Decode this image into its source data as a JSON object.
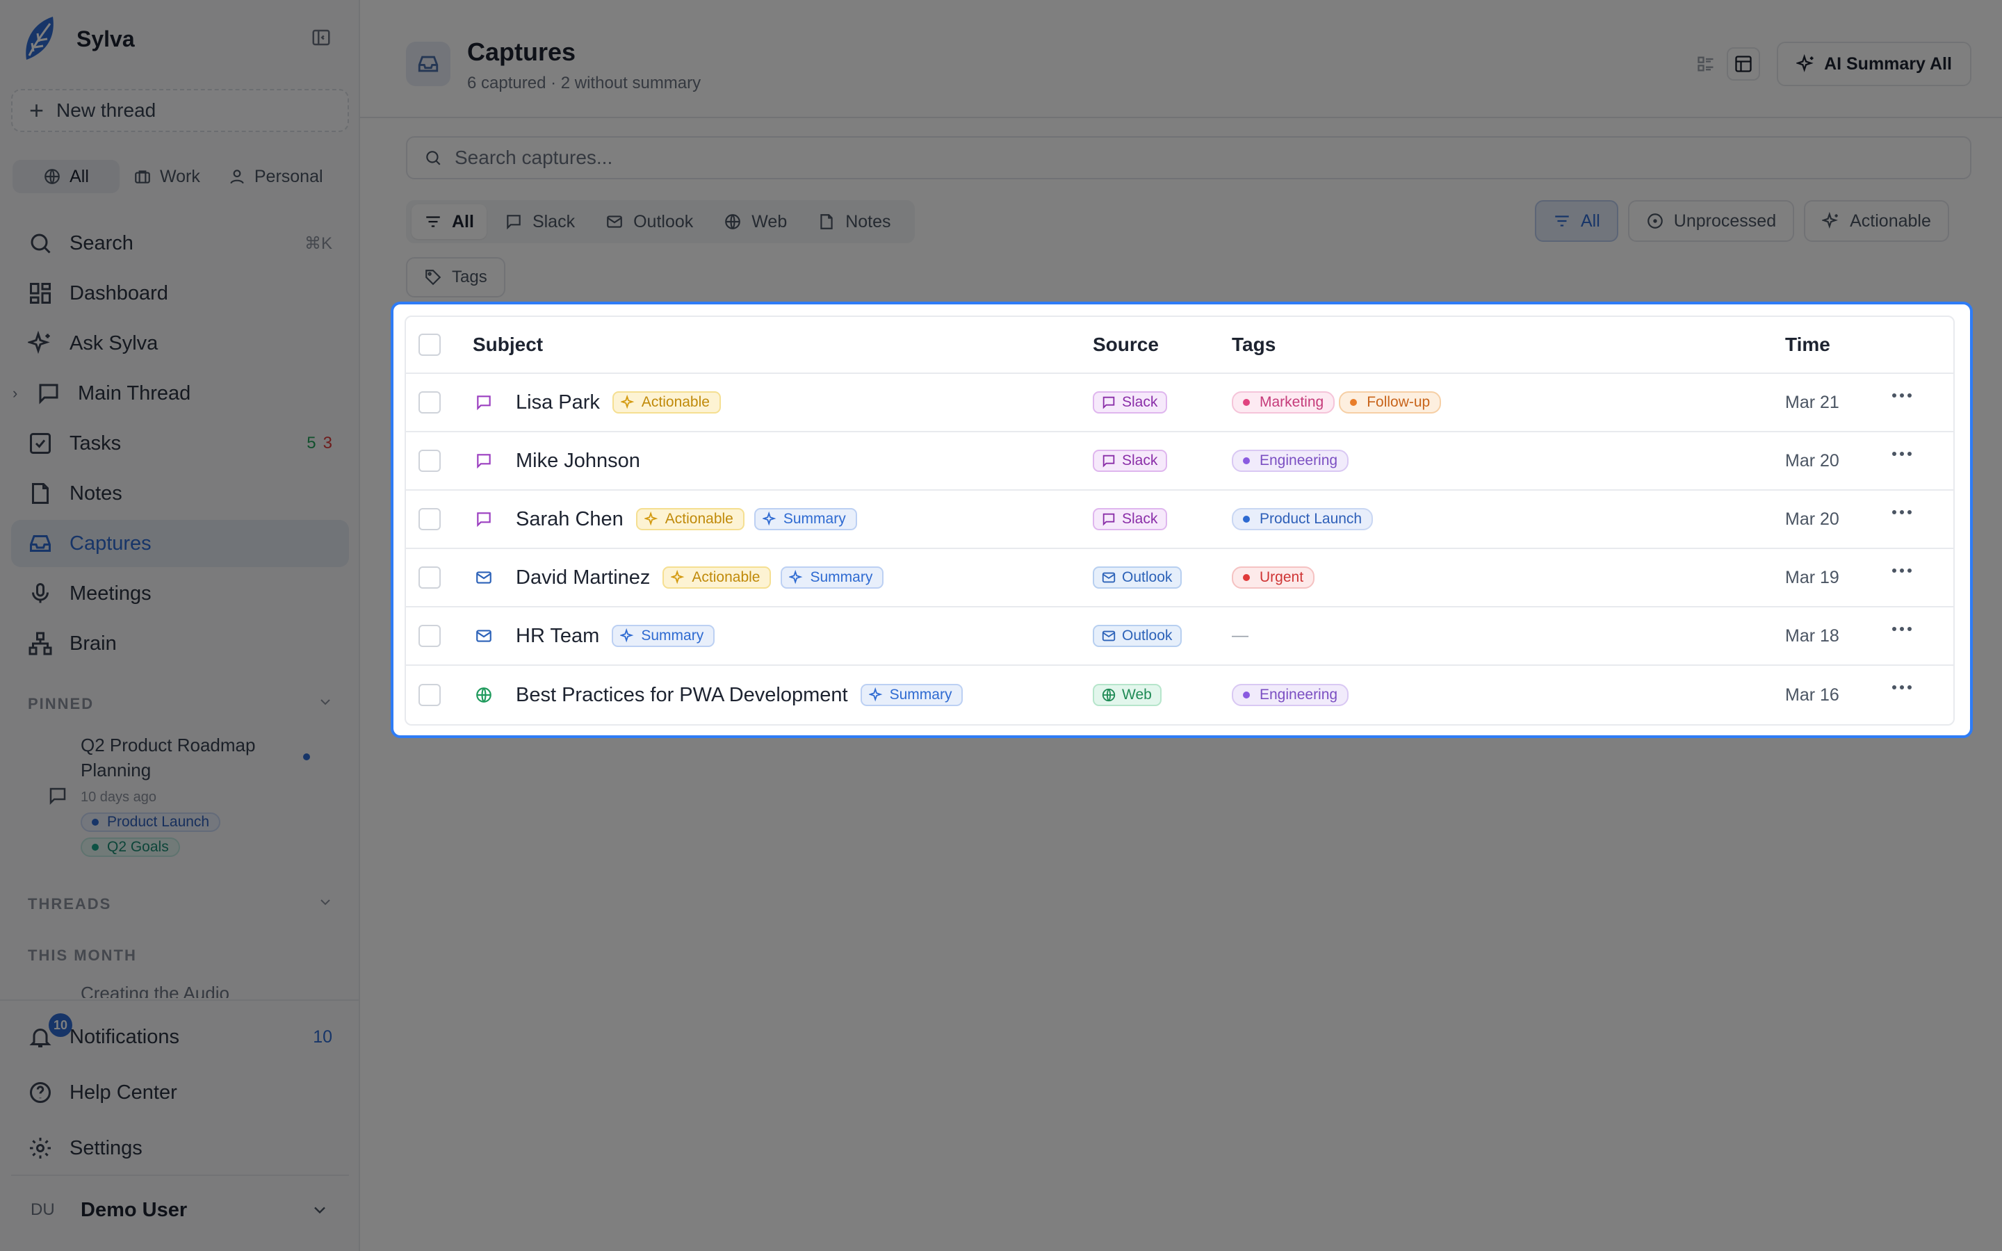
{
  "sidebar": {
    "brand": "Sylva",
    "new_thread": "New thread",
    "scopes": [
      "All",
      "Work",
      "Personal"
    ],
    "nav": [
      {
        "label": "Search",
        "kbd": "⌘K"
      },
      {
        "label": "Dashboard"
      },
      {
        "label": "Ask Sylva"
      },
      {
        "label": "Main Thread"
      },
      {
        "label": "Tasks",
        "count_done": "5",
        "count_open": "3"
      },
      {
        "label": "Notes"
      },
      {
        "label": "Captures"
      },
      {
        "label": "Meetings"
      },
      {
        "label": "Brain"
      }
    ],
    "pinned_heading": "PINNED",
    "pinned": {
      "title": "Q2 Product Roadmap Planning",
      "time": "10 days ago",
      "tags": [
        "Product Launch",
        "Q2 Goals"
      ]
    },
    "threads_heading": "THREADS",
    "this_month_heading": "THIS MONTH",
    "thread_partial": "Creating the Audio",
    "bottom": {
      "notifications": "Notifications",
      "notifications_count": "10",
      "notifications_badge": "10",
      "help": "Help Center",
      "settings": "Settings"
    },
    "user": {
      "initials": "DU",
      "name": "Demo User"
    }
  },
  "header": {
    "title": "Captures",
    "subtitle": "6 captured · 2 without summary",
    "ai_button": "AI Summary All"
  },
  "search": {
    "placeholder": "Search captures..."
  },
  "source_tabs": [
    "All",
    "Slack",
    "Outlook",
    "Web",
    "Notes"
  ],
  "status_filters": [
    "All",
    "Unprocessed",
    "Actionable"
  ],
  "tags_button": "Tags",
  "table": {
    "columns": {
      "subject": "Subject",
      "source": "Source",
      "tags": "Tags",
      "time": "Time"
    },
    "rows": [
      {
        "subject": "Lisa Park",
        "source": "Slack",
        "time": "Mar 21",
        "actionable": "Actionable",
        "tags": [
          "Marketing",
          "Follow-up"
        ]
      },
      {
        "subject": "Mike Johnson",
        "source": "Slack",
        "time": "Mar 20",
        "tags": [
          "Engineering"
        ]
      },
      {
        "subject": "Sarah Chen",
        "source": "Slack",
        "time": "Mar 20",
        "actionable": "Actionable",
        "summary": "Summary",
        "tags": [
          "Product Launch"
        ]
      },
      {
        "subject": "David Martinez",
        "source": "Outlook",
        "time": "Mar 19",
        "actionable": "Actionable",
        "summary": "Summary",
        "tags": [
          "Urgent"
        ]
      },
      {
        "subject": "HR Team",
        "source": "Outlook",
        "time": "Mar 18",
        "summary": "Summary",
        "empty_tags": "—"
      },
      {
        "subject": "Best Practices for PWA Development",
        "source": "Web",
        "time": "Mar 16",
        "summary": "Summary",
        "tags": [
          "Engineering"
        ]
      }
    ]
  },
  "colors": {
    "accent": "#2e6ad1",
    "highlight_border": "#2e7cf6"
  }
}
